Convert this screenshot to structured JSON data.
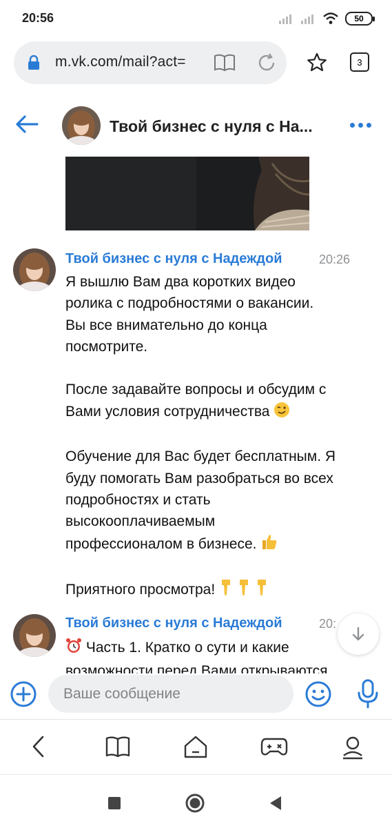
{
  "status_bar": {
    "time": "20:56",
    "battery": "50"
  },
  "browser": {
    "url": "m.vk.com/mail?act=",
    "tabs_count": "3"
  },
  "chat": {
    "title": "Твой бизнес с нуля с На..."
  },
  "messages": [
    {
      "author": "Твой бизнес с нуля с Надеждой",
      "time": "20:26",
      "text": "Я вышлю Вам два коротких видео\nролика с подробностями о вакансии.\nВы все внимательно до конца\nпосмотрите.\n\nПосле задавайте вопросы и обсудим с\nВами условия сотрудничества",
      "text2": "\n\nОбучение для Вас будет бесплатным. Я\nбуду помогать Вам разобраться во всех\nподробностях и стать\nвысокооплачиваемым\nпрофессионалом в бизнесе.",
      "text3": "\n\nПриятного просмотра!"
    },
    {
      "author": "Твой бизнес с нуля с Надеждой",
      "time": "20:",
      "text": "Часть 1. Кратко о сути и какие\nвозможности перед Вами открываются"
    }
  ],
  "composer": {
    "placeholder": "Ваше сообщение"
  },
  "icons": {
    "lock": "lock-icon",
    "reader": "reader-mode-icon",
    "reload": "reload-icon",
    "star": "star-icon",
    "back": "back-arrow-icon",
    "more": "more-dots-icon",
    "attach": "plus-circle-icon",
    "emoji": "smiley-icon",
    "mic": "microphone-icon",
    "scroll_down": "arrow-down-icon"
  },
  "colors": {
    "accent": "#2a7bd6",
    "time_gray": "#8f9194",
    "input_bg": "#eeeff1"
  }
}
